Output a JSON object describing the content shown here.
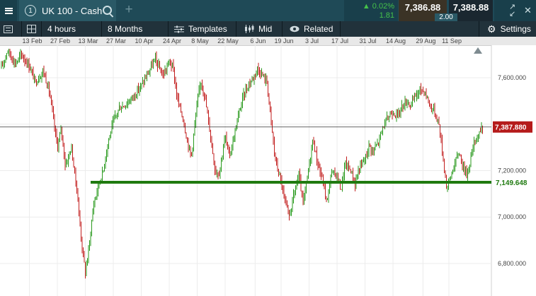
{
  "header": {
    "instrument_number": "1",
    "instrument_name": "UK 100 - Cash",
    "change_percent": "0.02%",
    "change_points": "1.81",
    "sell_price": "7,386.88",
    "buy_price": "7,388.88",
    "spread": "2.00"
  },
  "toolbar": {
    "interval": "4 hours",
    "range": "8 Months",
    "templates_label": "Templates",
    "price_type": "Mid",
    "related_label": "Related",
    "settings_label": "Settings"
  },
  "chart_data": {
    "type": "candlestick",
    "x_tick_labels": [
      "13 Feb",
      "27 Feb",
      "13 Mar",
      "27 Mar",
      "10 Apr",
      "24 Apr",
      "8 May",
      "22 May",
      "6 Jun",
      "19 Jun",
      "3 Jul",
      "17 Jul",
      "31 Jul",
      "14 Aug",
      "29 Aug",
      "11 Sep"
    ],
    "y_tick_labels": [
      "7,600.000",
      "7,400.000",
      "7,200.000",
      "7,000.000",
      "6,800.000"
    ],
    "y_ticks": [
      7600,
      7400,
      7200,
      7000,
      6800
    ],
    "ylim": [
      6660,
      7740
    ],
    "current_price": 7387.88,
    "current_price_label": "7,387.880",
    "support_level": 7149.648,
    "support_label": "7,149.648",
    "up_color": "#2a9a1e",
    "down_color": "#c21d1d",
    "support_color": "#1f7a0f",
    "price_label_color": "#b51a1a",
    "anchors": [
      [
        "2023-01-30",
        7640
      ],
      [
        "2023-02-02",
        7720
      ],
      [
        "2023-02-06",
        7660
      ],
      [
        "2023-02-09",
        7700
      ],
      [
        "2023-02-13",
        7650
      ],
      [
        "2023-02-16",
        7580
      ],
      [
        "2023-02-20",
        7630
      ],
      [
        "2023-02-23",
        7540
      ],
      [
        "2023-02-27",
        7300
      ],
      [
        "2023-03-01",
        7380
      ],
      [
        "2023-03-03",
        7220
      ],
      [
        "2023-03-06",
        7300
      ],
      [
        "2023-03-09",
        7100
      ],
      [
        "2023-03-11",
        6900
      ],
      [
        "2023-03-13",
        6760
      ],
      [
        "2023-03-15",
        6880
      ],
      [
        "2023-03-17",
        7050
      ],
      [
        "2023-03-20",
        7150
      ],
      [
        "2023-03-22",
        7200
      ],
      [
        "2023-03-24",
        7310
      ],
      [
        "2023-03-27",
        7410
      ],
      [
        "2023-03-30",
        7470
      ],
      [
        "2023-04-03",
        7490
      ],
      [
        "2023-04-07",
        7530
      ],
      [
        "2023-04-11",
        7580
      ],
      [
        "2023-04-14",
        7630
      ],
      [
        "2023-04-17",
        7680
      ],
      [
        "2023-04-19",
        7640
      ],
      [
        "2023-04-21",
        7610
      ],
      [
        "2023-04-24",
        7670
      ],
      [
        "2023-04-26",
        7640
      ],
      [
        "2023-04-28",
        7510
      ],
      [
        "2023-05-01",
        7420
      ],
      [
        "2023-05-03",
        7330
      ],
      [
        "2023-05-05",
        7260
      ],
      [
        "2023-05-08",
        7490
      ],
      [
        "2023-05-10",
        7590
      ],
      [
        "2023-05-12",
        7510
      ],
      [
        "2023-05-15",
        7330
      ],
      [
        "2023-05-17",
        7200
      ],
      [
        "2023-05-19",
        7190
      ],
      [
        "2023-05-22",
        7350
      ],
      [
        "2023-05-24",
        7260
      ],
      [
        "2023-05-26",
        7330
      ],
      [
        "2023-05-29",
        7450
      ],
      [
        "2023-05-31",
        7520
      ],
      [
        "2023-06-02",
        7560
      ],
      [
        "2023-06-05",
        7600
      ],
      [
        "2023-06-07",
        7640
      ],
      [
        "2023-06-09",
        7620
      ],
      [
        "2023-06-12",
        7580
      ],
      [
        "2023-06-14",
        7410
      ],
      [
        "2023-06-16",
        7250
      ],
      [
        "2023-06-19",
        7150
      ],
      [
        "2023-06-21",
        7060
      ],
      [
        "2023-06-23",
        7000
      ],
      [
        "2023-06-26",
        7120
      ],
      [
        "2023-06-28",
        7180
      ],
      [
        "2023-06-30",
        7050
      ],
      [
        "2023-07-03",
        7220
      ],
      [
        "2023-07-05",
        7340
      ],
      [
        "2023-07-07",
        7240
      ],
      [
        "2023-07-10",
        7150
      ],
      [
        "2023-07-12",
        7060
      ],
      [
        "2023-07-14",
        7190
      ],
      [
        "2023-07-17",
        7180
      ],
      [
        "2023-07-19",
        7120
      ],
      [
        "2023-07-21",
        7230
      ],
      [
        "2023-07-24",
        7200
      ],
      [
        "2023-07-26",
        7140
      ],
      [
        "2023-07-28",
        7210
      ],
      [
        "2023-07-31",
        7250
      ],
      [
        "2023-08-02",
        7310
      ],
      [
        "2023-08-04",
        7280
      ],
      [
        "2023-08-07",
        7330
      ],
      [
        "2023-08-09",
        7390
      ],
      [
        "2023-08-11",
        7420
      ],
      [
        "2023-08-14",
        7460
      ],
      [
        "2023-08-16",
        7430
      ],
      [
        "2023-08-18",
        7470
      ],
      [
        "2023-08-21",
        7500
      ],
      [
        "2023-08-23",
        7480
      ],
      [
        "2023-08-25",
        7520
      ],
      [
        "2023-08-28",
        7550
      ],
      [
        "2023-08-30",
        7540
      ],
      [
        "2023-09-01",
        7490
      ],
      [
        "2023-09-04",
        7450
      ],
      [
        "2023-09-06",
        7400
      ],
      [
        "2023-09-08",
        7260
      ],
      [
        "2023-09-10",
        7120
      ],
      [
        "2023-09-12",
        7180
      ],
      [
        "2023-09-14",
        7230
      ],
      [
        "2023-09-16",
        7280
      ],
      [
        "2023-09-18",
        7220
      ],
      [
        "2023-09-20",
        7180
      ],
      [
        "2023-09-22",
        7260
      ],
      [
        "2023-09-24",
        7330
      ],
      [
        "2023-09-26",
        7360
      ],
      [
        "2023-09-28",
        7390
      ]
    ]
  }
}
